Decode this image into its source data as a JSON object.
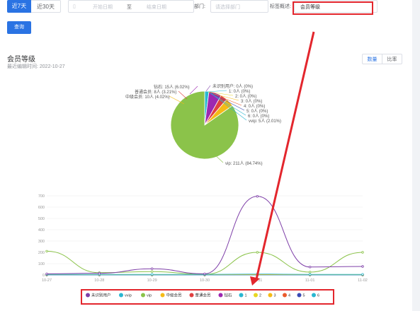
{
  "filters": {
    "tab_7": "近7天",
    "tab_30": "近30天",
    "start_placeholder": "开始日期",
    "to": "至",
    "end_placeholder": "结束日期",
    "dept_label": "部门:",
    "dept_placeholder": "请选择部门",
    "tag_label": "标签概述:",
    "tag_value": "会员等级",
    "search_label": "查询"
  },
  "card": {
    "title": "会员等级",
    "subtitle": "最近编辑时间: 2022-10-27",
    "toggle_count": "数量",
    "toggle_ratio": "比率"
  },
  "colors": {
    "primary": "#2a73e3",
    "red_annotation": "#e3262d"
  },
  "pie_labels": [
    {
      "text": "钻石: 15人 (6.02%)",
      "color": "#9d27b0"
    },
    {
      "text": "普通会员: 8人 (3.21%)",
      "color": "#e04040"
    },
    {
      "text": "中级会员: 10人 (4.02%)",
      "color": "#f5bb17"
    },
    {
      "text": "未识别用户: 0人 (0%)",
      "color": "#7e3fa8"
    },
    {
      "text": "1: 0人 (0%)",
      "color": "#2ab7d1"
    },
    {
      "text": "2: 0人 (0%)",
      "color": "#e7d722"
    },
    {
      "text": "3: 0人 (0%)",
      "color": "#f5bb17"
    },
    {
      "text": "4: 0人 (0%)",
      "color": "#ea5b2d"
    },
    {
      "text": "5: 0人 (0%)",
      "color": "#3a4bb5"
    },
    {
      "text": "6: 0人 (0%)",
      "color": "#2ab7d1"
    },
    {
      "text": "vvip: 5人 (2.01%)",
      "color": "#2ab7d1"
    },
    {
      "text": "vip: 211人 (84.74%)",
      "color": "#8bc34a"
    }
  ],
  "chart_data": [
    {
      "type": "pie",
      "slices": [
        {
          "name": "vip",
          "value": 211,
          "percent": 84.74,
          "color": "#8bc34a"
        },
        {
          "name": "中级会员",
          "value": 10,
          "percent": 4.02,
          "color": "#f5bb17"
        },
        {
          "name": "普通会员",
          "value": 8,
          "percent": 3.21,
          "color": "#e04040"
        },
        {
          "name": "钻石",
          "value": 15,
          "percent": 6.02,
          "color": "#9d27b0"
        },
        {
          "name": "vvip",
          "value": 5,
          "percent": 2.01,
          "color": "#2ab7d1"
        },
        {
          "name": "未识别用户",
          "value": 0,
          "percent": 0,
          "color": "#7e3fa8"
        }
      ]
    },
    {
      "type": "line",
      "categories": [
        "10-27",
        "10-28",
        "10-29",
        "10-30",
        "10-31",
        "11-01",
        "11-02"
      ],
      "yticks": [
        0,
        100,
        200,
        300,
        400,
        500,
        600,
        700
      ],
      "ylim": [
        0,
        700
      ],
      "smooth": true,
      "series": [
        {
          "name": "未识别用户",
          "color": "#7e3fa8",
          "values": [
            10,
            15,
            55,
            10,
            695,
            70,
            75
          ]
        },
        {
          "name": "vvip",
          "color": "#2ab7d1",
          "values": [
            5,
            5,
            5,
            5,
            8,
            5,
            5
          ]
        },
        {
          "name": "vip",
          "color": "#8bc34a",
          "values": [
            210,
            20,
            30,
            5,
            200,
            25,
            200
          ]
        },
        {
          "name": "中级会员",
          "color": "#f5bb17",
          "values": [
            3,
            3,
            3,
            3,
            3,
            3,
            3
          ]
        },
        {
          "name": "普通会员",
          "color": "#e04040",
          "values": [
            3,
            3,
            3,
            3,
            3,
            3,
            3
          ]
        },
        {
          "name": "钻石",
          "color": "#9d27b0",
          "values": [
            2,
            2,
            2,
            2,
            2,
            2,
            2
          ]
        },
        {
          "name": "1",
          "color": "#2ab7d1",
          "values": [
            0,
            0,
            0,
            0,
            0,
            0,
            0
          ]
        },
        {
          "name": "2",
          "color": "#e7d722",
          "values": [
            0,
            0,
            0,
            0,
            0,
            0,
            0
          ]
        },
        {
          "name": "3",
          "color": "#f5bb17",
          "values": [
            0,
            0,
            0,
            0,
            0,
            0,
            0
          ]
        },
        {
          "name": "4",
          "color": "#ea5b2d",
          "values": [
            0,
            0,
            0,
            0,
            0,
            0,
            0
          ]
        },
        {
          "name": "5",
          "color": "#3a4bb5",
          "values": [
            0,
            0,
            0,
            0,
            0,
            0,
            0
          ]
        },
        {
          "name": "6",
          "color": "#2ab7d1",
          "values": [
            0,
            0,
            0,
            0,
            0,
            0,
            0
          ]
        }
      ]
    }
  ]
}
